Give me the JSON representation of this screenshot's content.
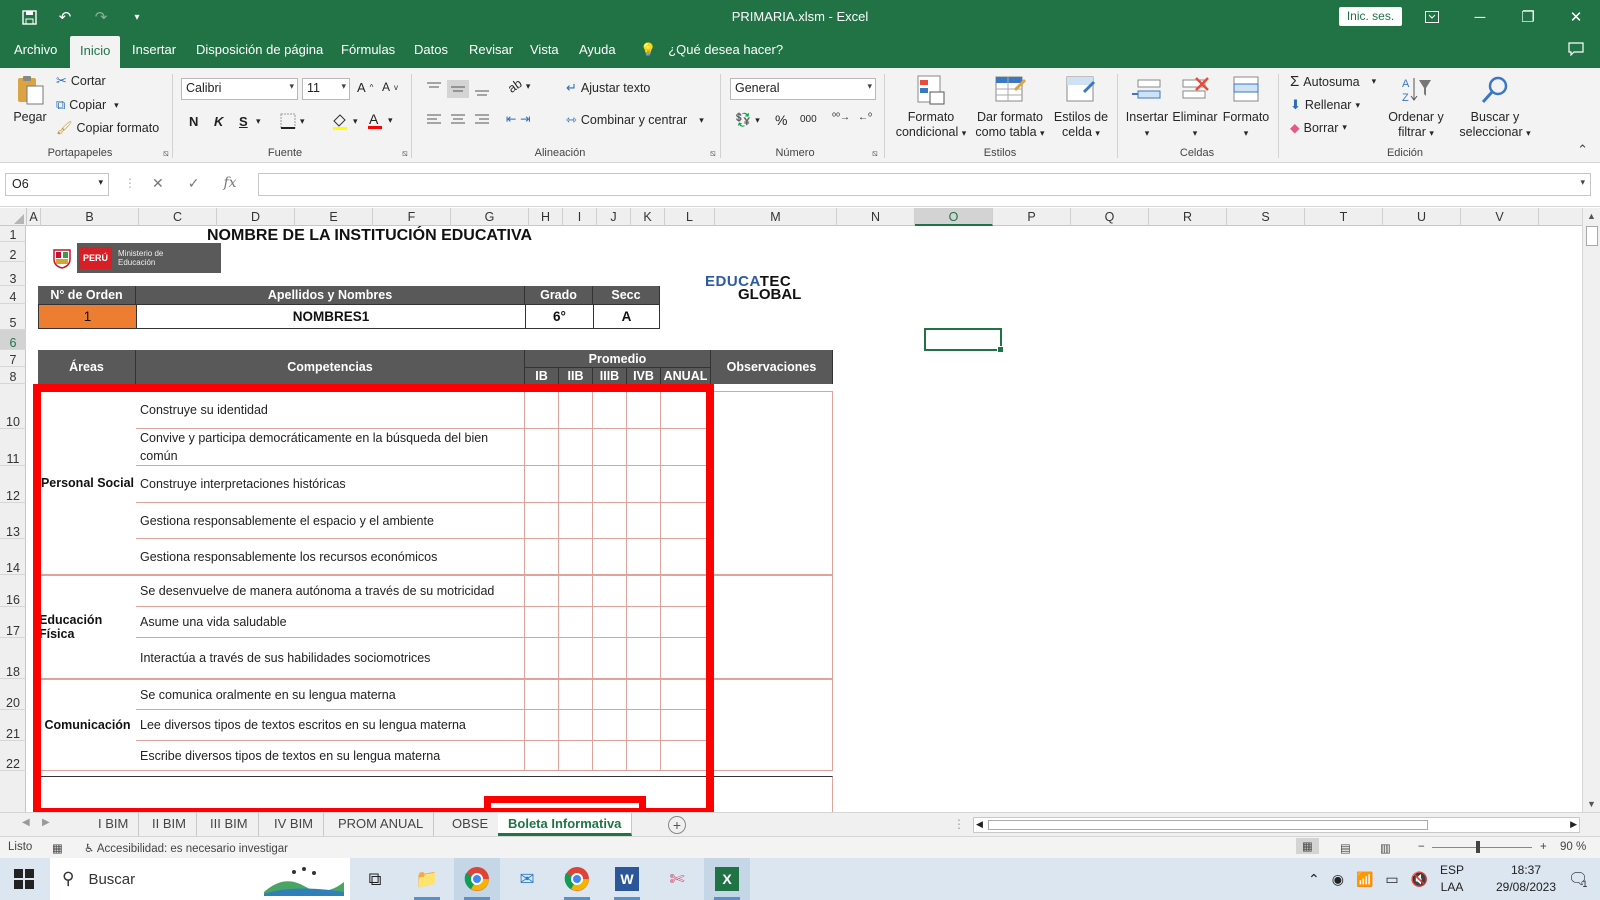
{
  "window": {
    "title": "PRIMARIA.xlsm - Excel",
    "signin": "Inic. ses."
  },
  "tabs": [
    "Archivo",
    "Inicio",
    "Insertar",
    "Disposición de página",
    "Fórmulas",
    "Datos",
    "Revisar",
    "Vista",
    "Ayuda"
  ],
  "tell_me": "¿Qué desea hacer?",
  "ribbon": {
    "clipboard": {
      "paste": "Pegar",
      "cut": "Cortar",
      "copy": "Copiar",
      "format_painter": "Copiar formato",
      "label": "Portapapeles"
    },
    "font": {
      "name": "Calibri",
      "size": "11",
      "bold": "N",
      "italic": "K",
      "underline": "S",
      "label": "Fuente"
    },
    "alignment": {
      "wrap": "Ajustar texto",
      "merge": "Combinar y centrar",
      "label": "Alineación"
    },
    "number": {
      "format": "General",
      "percent": "%",
      "thousands": "000",
      "label": "Número"
    },
    "styles": {
      "conditional": "Formato condicional",
      "as_table": "Dar formato como tabla",
      "cell_styles": "Estilos de celda",
      "label": "Estilos"
    },
    "cells": {
      "insert": "Insertar",
      "delete": "Eliminar",
      "format": "Formato",
      "label": "Celdas"
    },
    "editing": {
      "autosum": "Autosuma",
      "fill": "Rellenar",
      "clear": "Borrar",
      "sort": "Ordenar y filtrar",
      "find": "Buscar y seleccionar",
      "label": "Edición"
    }
  },
  "formula_bar": {
    "name_box": "O6",
    "fx": "fx",
    "value": ""
  },
  "grid": {
    "columns": [
      {
        "name": "A",
        "w": 14
      },
      {
        "name": "B",
        "w": 98
      },
      {
        "name": "C",
        "w": 78
      },
      {
        "name": "D",
        "w": 78
      },
      {
        "name": "E",
        "w": 78
      },
      {
        "name": "F",
        "w": 78
      },
      {
        "name": "G",
        "w": 78
      },
      {
        "name": "H",
        "w": 34
      },
      {
        "name": "I",
        "w": 34
      },
      {
        "name": "J",
        "w": 34
      },
      {
        "name": "K",
        "w": 34
      },
      {
        "name": "L",
        "w": 50
      },
      {
        "name": "M",
        "w": 122
      },
      {
        "name": "N",
        "w": 78
      },
      {
        "name": "O",
        "w": 78
      },
      {
        "name": "P",
        "w": 78
      },
      {
        "name": "Q",
        "w": 78
      },
      {
        "name": "R",
        "w": 78
      },
      {
        "name": "S",
        "w": 78
      },
      {
        "name": "T",
        "w": 78
      },
      {
        "name": "U",
        "w": 78
      },
      {
        "name": "V",
        "w": 78
      }
    ],
    "selected_column": "O",
    "rows": [
      "1",
      "2",
      "3",
      "4",
      "5",
      "6",
      "7",
      "8",
      "10",
      "11",
      "12",
      "13",
      "14",
      "16",
      "17",
      "18",
      "20",
      "21",
      "22"
    ],
    "selected_row": "6"
  },
  "sheet": {
    "institution_title": "NOMBRE DE LA INSTITUCIÓN EDUCATIVA",
    "logo": {
      "badge": "PERÚ",
      "ministry": "Ministerio de Educación"
    },
    "edu_logo": {
      "line1_a": "EDU",
      "line1_b": "CA",
      "line1_c": "TEC",
      "line2": "GLOBAL"
    },
    "student_header": {
      "order": "N° de Orden",
      "names": "Apellidos y Nombres",
      "grade": "Grado",
      "section": "Secc"
    },
    "student": {
      "order": "1",
      "names": "NOMBRES1",
      "grade": "6°",
      "section": "A"
    },
    "table_header": {
      "areas": "Áreas",
      "competencies": "Competencias",
      "average": "Promedio",
      "periods": [
        "IB",
        "IIB",
        "IIIB",
        "IVB",
        "ANUAL"
      ],
      "observations": "Observaciones"
    },
    "areas": [
      {
        "name": "Personal Social",
        "competencies": [
          "Construye su identidad",
          "Convive y participa democráticamente en la búsqueda del bien común",
          "Construye interpretaciones históricas",
          "Gestiona responsablemente el espacio y el ambiente",
          "Gestiona responsablemente los recursos económicos"
        ]
      },
      {
        "name": "Educación Física",
        "competencies": [
          "Se desenvuelve de manera autónoma a través de su motricidad",
          "Asume una vida saludable",
          "Interactúa a través de sus habilidades sociomotrices"
        ]
      },
      {
        "name": "Comunicación",
        "competencies": [
          "Se comunica oralmente en su lengua materna",
          "Lee diversos tipos de textos escritos en su lengua materna",
          "Escribe diversos tipos de textos en su lengua materna"
        ]
      }
    ]
  },
  "sheet_tabs": [
    "I BIM",
    "II BIM",
    "III BIM",
    "IV BIM",
    "PROM ANUAL",
    "OBSE",
    "Boleta Informativa"
  ],
  "active_sheet": "Boleta Informativa",
  "status": {
    "ready": "Listo",
    "accessibility": "Accesibilidad: es necesario investigar",
    "zoom": "90 %"
  },
  "taskbar": {
    "search": "Buscar",
    "lang1": "ESP",
    "lang2": "LAA",
    "time": "18:37",
    "date": "29/08/2023",
    "notif": "1"
  }
}
